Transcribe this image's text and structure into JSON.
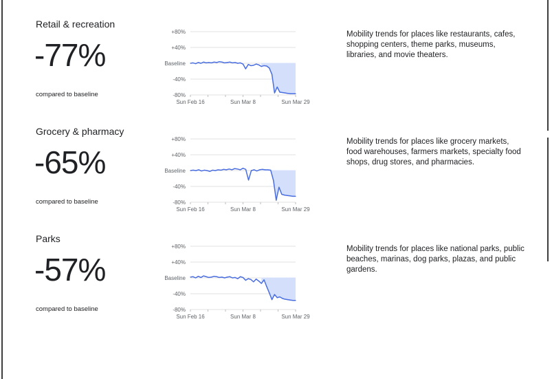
{
  "chart_data": [
    {
      "type": "area",
      "title": "Retail & recreation",
      "headline_value": "-77%",
      "headline_caption": "compared to baseline",
      "description": "Mobility trends for places like restaurants, cafes, shopping centers, theme parks, museums, libraries, and movie theaters.",
      "y_ticks": [
        "+80%",
        "+40%",
        "Baseline",
        "-40%",
        "-80%"
      ],
      "y_tick_values": [
        80,
        40,
        0,
        -40,
        -80
      ],
      "ylim": [
        -80,
        80
      ],
      "x_ticks": [
        "Sun Feb 16",
        "Sun Mar 8",
        "Sun Mar 29"
      ],
      "x_tick_days": [
        0,
        21,
        42
      ],
      "x_start_date": "2020-02-16",
      "shaded_from_day": 29,
      "color": "#4a6ee0",
      "fill_color": "#d4e0fb",
      "y": [
        0,
        1,
        -1,
        2,
        0,
        3,
        1,
        2,
        1,
        3,
        2,
        4,
        3,
        1,
        2,
        3,
        1,
        2,
        0,
        1,
        -2,
        -14,
        -3,
        -6,
        -5,
        -2,
        -4,
        -8,
        -6,
        -7,
        -12,
        -28,
        -75,
        -60,
        -73,
        -74,
        -75,
        -76,
        -77,
        -77,
        -77
      ]
    },
    {
      "type": "area",
      "title": "Grocery & pharmacy",
      "headline_value": "-65%",
      "headline_caption": "compared to baseline",
      "description": "Mobility trends for places like grocery markets, food warehouses, farmers markets, specialty food shops, drug stores, and pharmacies.",
      "y_ticks": [
        "+80%",
        "+40%",
        "Baseline",
        "-40%",
        "-80%"
      ],
      "y_tick_values": [
        80,
        40,
        0,
        -40,
        -80
      ],
      "ylim": [
        -80,
        80
      ],
      "x_ticks": [
        "Sun Feb 16",
        "Sun Mar 8",
        "Sun Mar 29"
      ],
      "x_tick_days": [
        0,
        21,
        42
      ],
      "x_start_date": "2020-02-16",
      "shaded_from_day": 29,
      "color": "#4a6ee0",
      "fill_color": "#d4e0fb",
      "y": [
        0,
        1,
        0,
        2,
        -1,
        1,
        0,
        -2,
        1,
        0,
        2,
        1,
        3,
        2,
        4,
        2,
        5,
        4,
        2,
        6,
        3,
        -24,
        0,
        2,
        -1,
        2,
        3,
        2,
        2,
        1,
        -25,
        -75,
        -42,
        -60,
        -62,
        -63,
        -64,
        -65,
        -65
      ]
    },
    {
      "type": "area",
      "title": "Parks",
      "headline_value": "-57%",
      "headline_caption": "compared to baseline",
      "description": "Mobility trends for places like national parks, public beaches, marinas, dog parks, plazas, and public gardens.",
      "y_ticks": [
        "+80%",
        "+40%",
        "Baseline",
        "-40%",
        "-80%"
      ],
      "y_tick_values": [
        80,
        40,
        0,
        -40,
        -80
      ],
      "ylim": [
        -80,
        80
      ],
      "x_ticks": [
        "Sun Feb 16",
        "Sun Mar 8",
        "Sun Mar 29"
      ],
      "x_tick_days": [
        0,
        21,
        42
      ],
      "x_start_date": "2020-02-16",
      "shaded_from_day": 29,
      "color": "#4a6ee0",
      "fill_color": "#d4e0fb",
      "y": [
        2,
        3,
        0,
        4,
        1,
        5,
        3,
        1,
        2,
        4,
        3,
        1,
        2,
        0,
        2,
        3,
        0,
        1,
        -2,
        3,
        1,
        -6,
        -2,
        -4,
        -10,
        -3,
        -8,
        -14,
        -5,
        -22,
        -38,
        -55,
        -42,
        -50,
        -48,
        -52,
        -54,
        -55,
        -56,
        -57,
        -57
      ]
    }
  ]
}
